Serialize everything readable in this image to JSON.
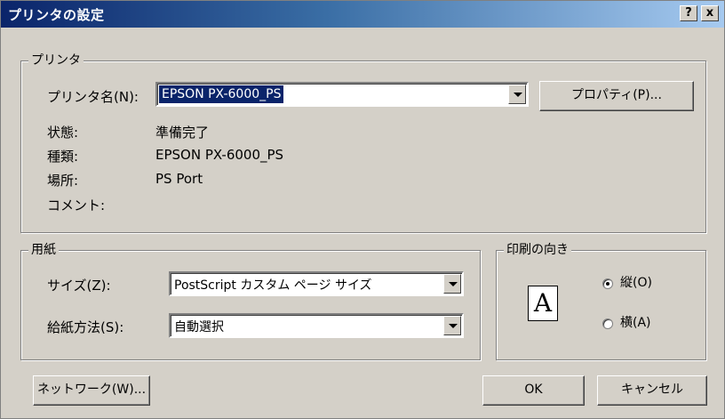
{
  "window": {
    "title": "プリンタの設定",
    "help_button": "?",
    "close_button": "x"
  },
  "printer_group": {
    "legend": "プリンタ",
    "name_label": "プリンタ名(N):",
    "name_value": "EPSON PX-6000_PS",
    "properties_button": "プロパティ(P)...",
    "status_label": "状態:",
    "status_value": "準備完了",
    "type_label": "種類:",
    "type_value": "EPSON PX-6000_PS",
    "location_label": "場所:",
    "location_value": "PS Port",
    "comment_label": "コメント:",
    "comment_value": ""
  },
  "paper_group": {
    "legend": "用紙",
    "size_label": "サイズ(Z):",
    "size_value": "PostScript カスタム ページ サイズ",
    "source_label": "給紙方法(S):",
    "source_value": "自動選択"
  },
  "orientation_group": {
    "legend": "印刷の向き",
    "icon_letter": "A",
    "portrait_label": "縦(O)",
    "landscape_label": "横(A)",
    "selected": "portrait"
  },
  "buttons": {
    "network": "ネットワーク(W)...",
    "ok": "OK",
    "cancel": "キャンセル"
  }
}
